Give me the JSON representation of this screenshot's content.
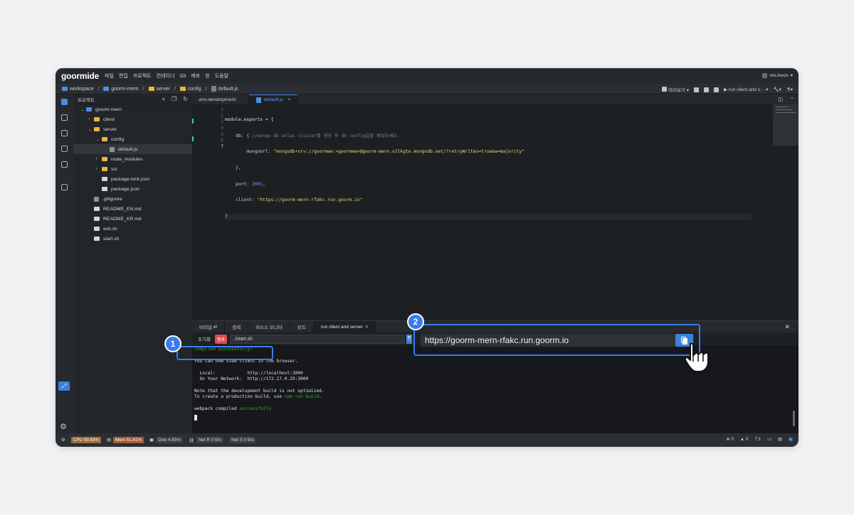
{
  "app": {
    "logo": "goormide",
    "user": "vivi.kwon"
  },
  "menu": [
    "파일",
    "편집",
    "프로젝트",
    "컨테이너",
    "Git",
    "배포",
    "창",
    "도움말"
  ],
  "breadcrumb": [
    "workspace",
    "goorm-mern",
    "server",
    "config",
    "default.js"
  ],
  "toolbar": {
    "preview": "미리보기",
    "run": "run client and s···"
  },
  "sidebar": {
    "title": "프로젝트",
    "tree": [
      {
        "label": "goorm-mern",
        "type": "root",
        "depth": 0,
        "expanded": true
      },
      {
        "label": "client",
        "type": "folder",
        "depth": 1,
        "expanded": false
      },
      {
        "label": "server",
        "type": "folder",
        "depth": 1,
        "expanded": true
      },
      {
        "label": "config",
        "type": "folder",
        "depth": 2,
        "expanded": true
      },
      {
        "label": "default.js",
        "type": "file",
        "depth": 3,
        "selected": true
      },
      {
        "label": "node_modules",
        "type": "folder",
        "depth": 2,
        "expanded": false
      },
      {
        "label": "src",
        "type": "folder",
        "depth": 2,
        "expanded": false
      },
      {
        "label": "package-lock.json",
        "type": "md",
        "depth": 2
      },
      {
        "label": "package.json",
        "type": "md",
        "depth": 2
      },
      {
        "label": ".gitignore",
        "type": "file",
        "depth": 1
      },
      {
        "label": "README_EN.md",
        "type": "md",
        "depth": 1
      },
      {
        "label": "README_KR.md",
        "type": "md",
        "depth": 1
      },
      {
        "label": "exit.sh",
        "type": "md",
        "depth": 1
      },
      {
        "label": "start.sh",
        "type": "md",
        "depth": 1
      }
    ]
  },
  "editor": {
    "tabs": [
      {
        "label": ".env.development",
        "active": false
      },
      {
        "label": "default.js",
        "active": true
      }
    ],
    "lines": [
      "1",
      "2",
      "3",
      "4",
      "5",
      "6",
      "7"
    ],
    "code": {
      "l1": "module.exports = {",
      "l2_key": "    db: { ",
      "l2_comment": "//mongo db atlas cluster를 생성 후 db config값을 채워주세요.",
      "l3_key": "        mongoUrl: ",
      "l3_value": "\"mongodb+srv://goormee:<goormee>@goorm-mern.o2lkgte.mongodb.net/?retryWrites=true&w=majority\"",
      "l4": "    },",
      "l5_key": "    port: ",
      "l5_value": "3001",
      "l5_end": ",",
      "l6_key": "    client: ",
      "l6_value": "\"https://goorm-mern-rfakc.run.goorm.io\"",
      "l7": "}"
    }
  },
  "terminal": {
    "tabs": [
      {
        "label": "터미널"
      },
      {
        "label": "검색"
      },
      {
        "label": "리소스 모니터"
      },
      {
        "label": "린트"
      },
      {
        "label": "run client and server",
        "active": true
      }
    ],
    "reset_label": "초기화",
    "stop_label": "종료",
    "command": "./start.sh",
    "output": {
      "compiled": "Compiled successfully!",
      "view": "You can now view client in the browser.",
      "local": "  Local:            http://localhost:3000",
      "network": "  On Your Network:  http://172.17.0.29:3000",
      "note1": "Note that the development build is not optimized.",
      "note2_pre": "To create a production build, use ",
      "note2_cmd": "npm run build",
      "note2_end": ".",
      "webpack_pre": "webpack compiled ",
      "webpack_ok": "successfully"
    }
  },
  "status": {
    "cpu": "CPU 43.63%",
    "mem": "Mem 51.41%",
    "disk": "Disk 4.65%",
    "net_r": "Net R 0 B/s",
    "net_s": "Net S 0 B/s",
    "errors": "0",
    "warnings": "0",
    "tab_size": "7:1"
  },
  "callouts": {
    "badge1": "1",
    "badge2": "2",
    "url": "https://goorm-mern-rfakc.run.goorm.io"
  },
  "colors": {
    "accent": "#3a7cf0",
    "success": "#2fb52f",
    "stop": "#e5484d"
  }
}
